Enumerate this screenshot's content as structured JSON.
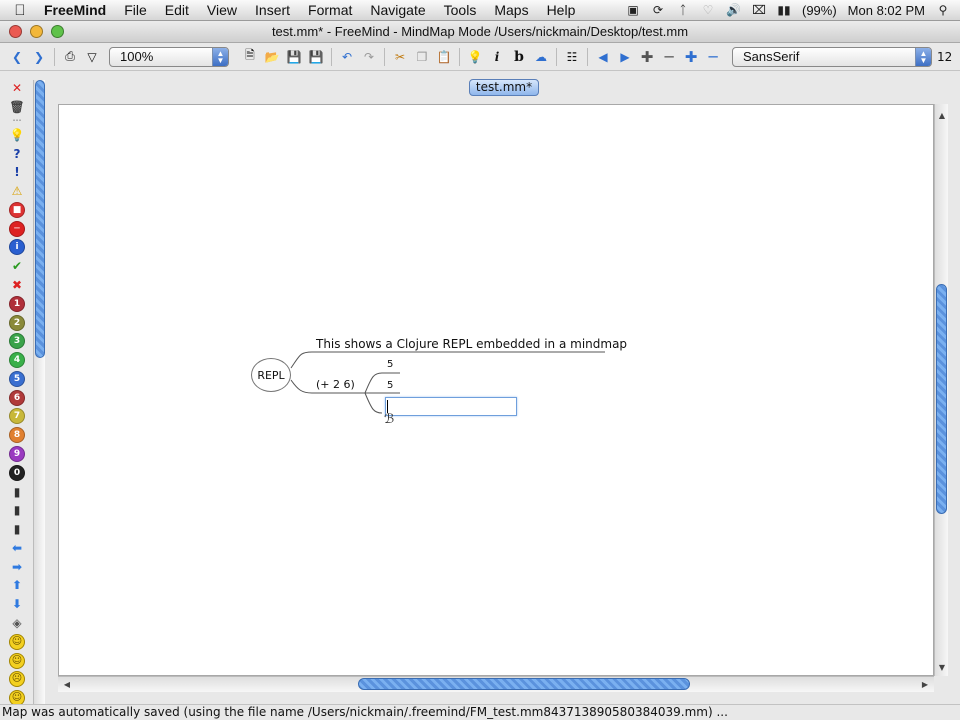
{
  "menubar": {
    "app_name": "FreeMind",
    "items": [
      "File",
      "Edit",
      "View",
      "Insert",
      "Format",
      "Navigate",
      "Tools",
      "Maps",
      "Help"
    ],
    "battery": "(99%)",
    "clock": "Mon 8:02 PM"
  },
  "window": {
    "title": "test.mm* - FreeMind - MindMap Mode /Users/nickmain/Desktop/test.mm"
  },
  "toolbar": {
    "zoom_value": "100%",
    "font_family": "SansSerif",
    "font_size": "12"
  },
  "tab": {
    "label": "test.mm*"
  },
  "mindmap": {
    "root_label": "REPL",
    "child_description": "This shows a Clojure REPL embedded in a mindmap",
    "child_expression": "(+ 2 6)",
    "result_top": "5",
    "result_bottom": "5",
    "edit_value": ""
  },
  "status": {
    "message": "Map was automatically saved (using the file name /Users/nickmain/.freemind/FM_test.mm843713890580384039.mm) ..."
  },
  "colors": {
    "accent": "#3d6fc4",
    "scroll_thumb": "#6aa1e8"
  }
}
